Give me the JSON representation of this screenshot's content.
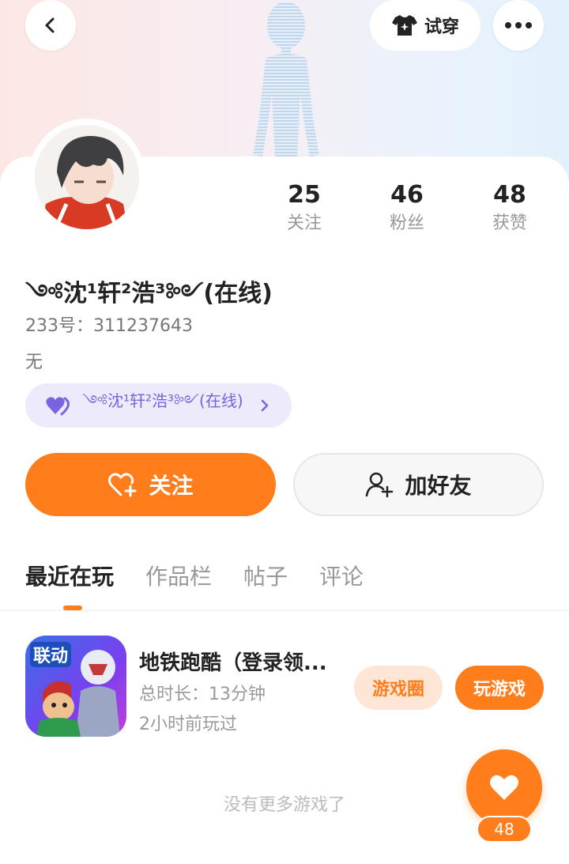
{
  "header": {
    "tryon_label": "试穿"
  },
  "profile": {
    "stats": [
      {
        "value": "25",
        "label": "关注"
      },
      {
        "value": "46",
        "label": "粉丝"
      },
      {
        "value": "48",
        "label": "获赞"
      }
    ],
    "nickname": "༺沈¹轩²浩³༻(在线)",
    "uid": "233号：311237643",
    "bio": "无",
    "cp_label": "༺沈¹轩²浩³༻(在线)"
  },
  "actions": {
    "follow_label": "关注",
    "add_friend_label": "加好友"
  },
  "tabs": [
    {
      "label": "最近在玩",
      "active": true
    },
    {
      "label": "作品栏",
      "active": false
    },
    {
      "label": "帖子",
      "active": false
    },
    {
      "label": "评论",
      "active": false
    }
  ],
  "games": [
    {
      "title": "地铁跑酷（登录领...",
      "playtime": "总时长：13分钟",
      "last_played": "2小时前玩过",
      "icon_badge": "联动",
      "circle_label": "游戏圈",
      "play_label": "玩游戏"
    }
  ],
  "footer": {
    "no_more": "没有更多游戏了",
    "like_count": "48"
  },
  "colors": {
    "accent": "#ff7d1a",
    "accent_soft": "#fde6d6",
    "cp_purple": "#7b63e0"
  }
}
